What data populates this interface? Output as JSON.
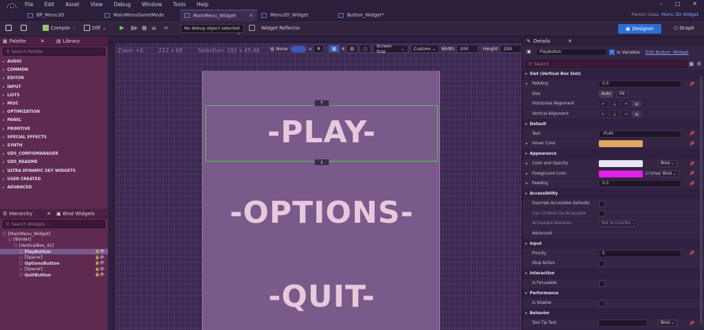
{
  "menubar": {
    "logo": "U",
    "items": [
      "File",
      "Edit",
      "Asset",
      "View",
      "Debug",
      "Window",
      "Tools",
      "Help"
    ],
    "controls": [
      "–",
      "□",
      "✕"
    ]
  },
  "tabs": [
    {
      "label": "BP_Menu3D",
      "active": false
    },
    {
      "label": "MainMenuGameMode",
      "active": false
    },
    {
      "label": "MainMenu_Widget",
      "active": true
    },
    {
      "label": "Menu3D_Widget",
      "active": false
    },
    {
      "label": "Button_Widget*",
      "active": false
    }
  ],
  "parent_class": {
    "label": "Parent class:",
    "value": "Menu 3D Widget"
  },
  "toolbar": {
    "compile": "Compile",
    "diff": "Diff",
    "debug_object": "No debug object selected",
    "widget_reflector": "Widget Reflector",
    "designer": "Designer",
    "graph": "Graph"
  },
  "palette": {
    "tab": "Palette",
    "library_tab": "Library",
    "search_placeholder": "Search Palette",
    "categories": [
      "AUDIO",
      "COMMON",
      "EDITOR",
      "INPUT",
      "LISTS",
      "MISC",
      "OPTIMIZATION",
      "PANEL",
      "PRIMITIVE",
      "SPECIAL EFFECTS",
      "SYNTH",
      "UDS_CONFIGMANAGER",
      "UDS_README",
      "ULTRA DYNAMIC SKY WIDGETS",
      "USER CREATED",
      "ADVANCED"
    ]
  },
  "hierarchy": {
    "tab": "Hierarchy",
    "bind_tab": "Bind Widgets",
    "search_placeholder": "Search Widgets",
    "items": [
      {
        "label": "[MainMenu_Widget]",
        "indent": 0
      },
      {
        "label": "[Border]",
        "indent": 1
      },
      {
        "label": "[VerticalBox_42]",
        "indent": 2
      },
      {
        "label": "PlayButton",
        "indent": 3,
        "selected": true
      },
      {
        "label": "[Spacer]",
        "indent": 3
      },
      {
        "label": "OptionsButton",
        "indent": 3
      },
      {
        "label": "[Spacer]",
        "indent": 3
      },
      {
        "label": "QuitButton",
        "indent": 3
      }
    ]
  },
  "canvas": {
    "zoom": "Zoom +0",
    "size": "212 x 68",
    "selection": "Selection: 192 x 45.46",
    "none_label": "None",
    "r_label": "R",
    "grid_count": "4",
    "screen_size": "Screen Size",
    "custom": "Custom",
    "width_label": "Width",
    "width_value": "200",
    "height_label": "Height",
    "height_value": "250",
    "buttons": [
      "-PLAY-",
      "-OPTIONS-",
      "-QUIT-"
    ],
    "handle_up": "↑",
    "handle_down": "↓"
  },
  "details": {
    "tab": "Details",
    "name": "PlayButton",
    "is_variable": "Is Variable",
    "edit_link": "Edit Button_Widget",
    "search_placeholder": "Search",
    "rows": [
      {
        "kind": "section",
        "label": "Slot (Vertical Box Slot)"
      },
      {
        "kind": "field",
        "label": "Padding",
        "value": "0.0",
        "expand": true
      },
      {
        "kind": "size",
        "label": "Size",
        "value": "Auto",
        "value2": "Fill"
      },
      {
        "kind": "align",
        "label": "Horizontal Alignment"
      },
      {
        "kind": "align",
        "label": "Vertical Alignment"
      },
      {
        "kind": "section",
        "label": "Default"
      },
      {
        "kind": "field",
        "label": "Text",
        "value": "-PLAY-"
      },
      {
        "kind": "swatch",
        "label": "Hover Color",
        "color": "#e0a860",
        "expand": true
      },
      {
        "kind": "section",
        "label": "Appearance"
      },
      {
        "kind": "swatchbind",
        "label": "Color and Opacity",
        "color": "#e8e4f4",
        "bind": "Bind",
        "expand": true
      },
      {
        "kind": "swatchinherit",
        "label": "Foreground Color",
        "color": "#e020e8",
        "inherit": "Inherit",
        "bind": "Bind",
        "expand": true
      },
      {
        "kind": "field",
        "label": "Padding",
        "value": "0.0",
        "expand": true
      },
      {
        "kind": "section",
        "label": "Accessibility"
      },
      {
        "kind": "check",
        "label": "Override Accessible Defaults"
      },
      {
        "kind": "check",
        "label": "Can Children be Accessible",
        "dim": true
      },
      {
        "kind": "dropdown",
        "label": "Accessible Behavior",
        "value": "Not Accessible",
        "dim": true
      },
      {
        "kind": "expand",
        "label": "Advanced"
      },
      {
        "kind": "section",
        "label": "Input"
      },
      {
        "kind": "field",
        "label": "Priority",
        "value": "0"
      },
      {
        "kind": "check",
        "label": "Stop Action"
      },
      {
        "kind": "section",
        "label": "Interaction"
      },
      {
        "kind": "check",
        "label": "Is Focusable"
      },
      {
        "kind": "section",
        "label": "Performance"
      },
      {
        "kind": "check",
        "label": "Is Volatile"
      },
      {
        "kind": "section",
        "label": "Behavior"
      },
      {
        "kind": "fieldbind",
        "label": "Tool Tip Text",
        "value": "",
        "bind": "Bind"
      }
    ]
  }
}
